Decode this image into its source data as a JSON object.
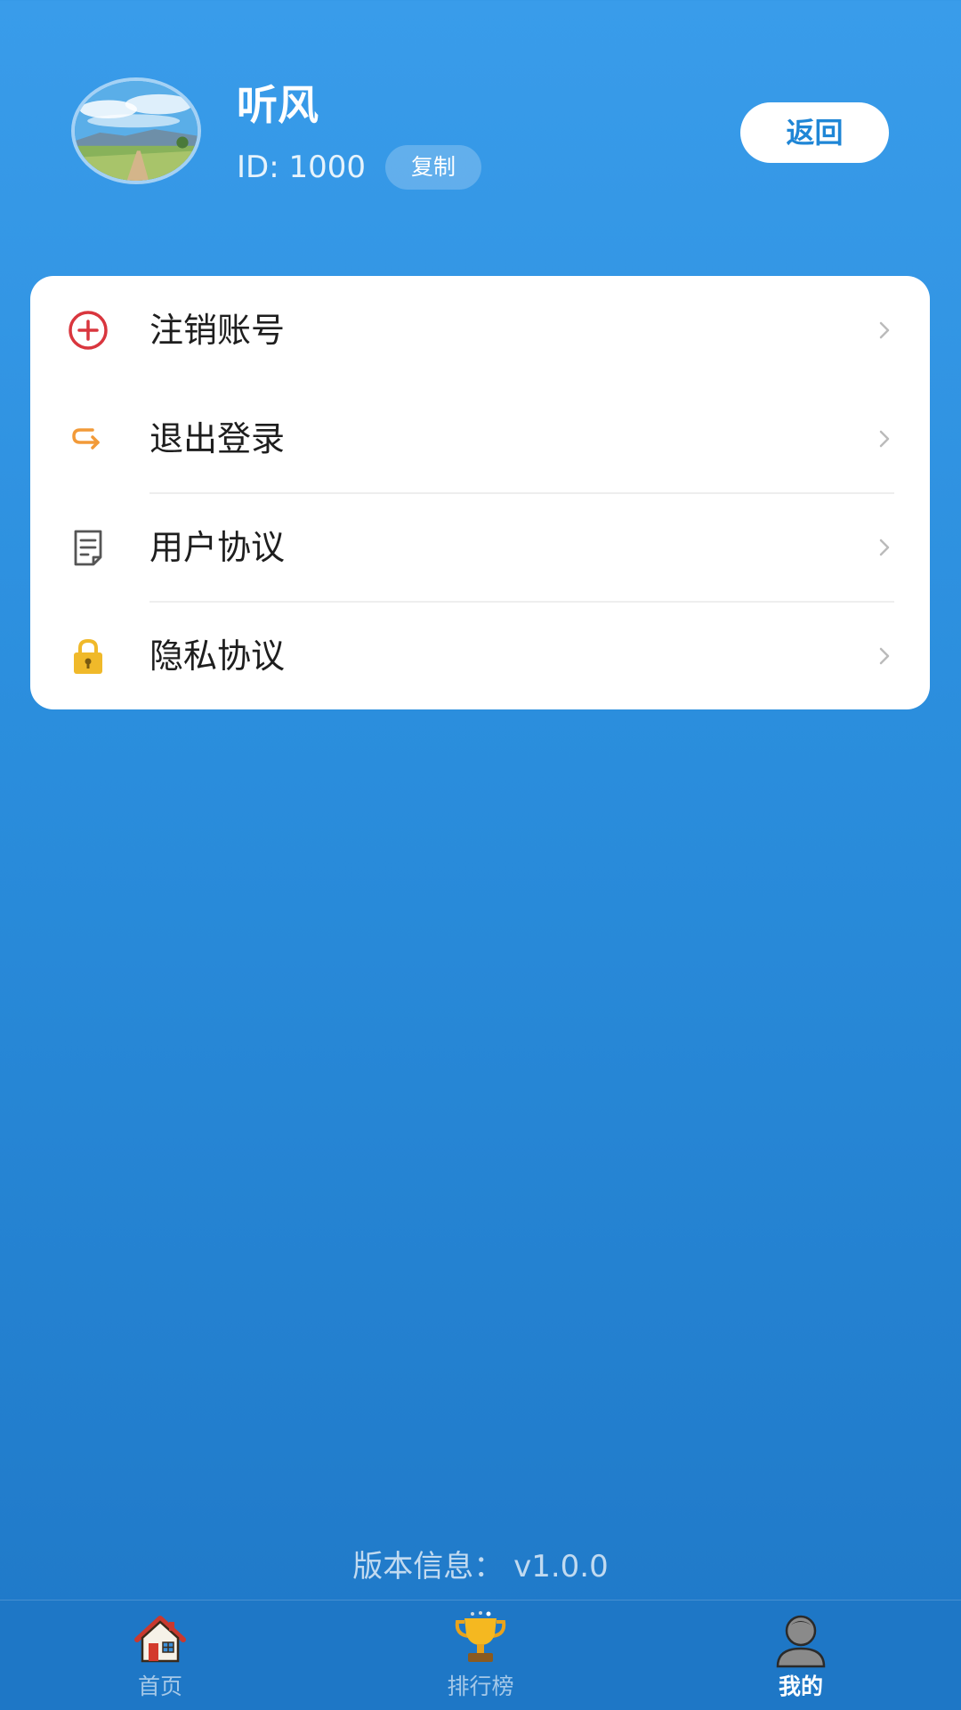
{
  "profile": {
    "username": "听风",
    "id_text": "ID: 1000",
    "copy_label": "复制",
    "back_label": "返回"
  },
  "menu": {
    "items": [
      {
        "label": "注销账号",
        "icon": "circle-plus-icon",
        "icon_color": "#d9363e"
      },
      {
        "label": "退出登录",
        "icon": "logout-arrow-icon",
        "icon_color": "#f29a38"
      },
      {
        "label": "用户协议",
        "icon": "document-icon",
        "icon_color": "#555555"
      },
      {
        "label": "隐私协议",
        "icon": "lock-icon",
        "icon_color": "#f0b92a"
      }
    ]
  },
  "version_text": "版本信息：  v1.0.0",
  "bottom_nav": {
    "items": [
      {
        "label": "首页",
        "icon": "house-icon",
        "active": false
      },
      {
        "label": "排行榜",
        "icon": "trophy-icon",
        "active": false
      },
      {
        "label": "我的",
        "icon": "user-avatar-icon",
        "active": true
      }
    ]
  },
  "colors": {
    "background_top": "#399cea",
    "background_bottom": "#1f78c7",
    "accent": "#1f86d6",
    "card": "#ffffff"
  }
}
